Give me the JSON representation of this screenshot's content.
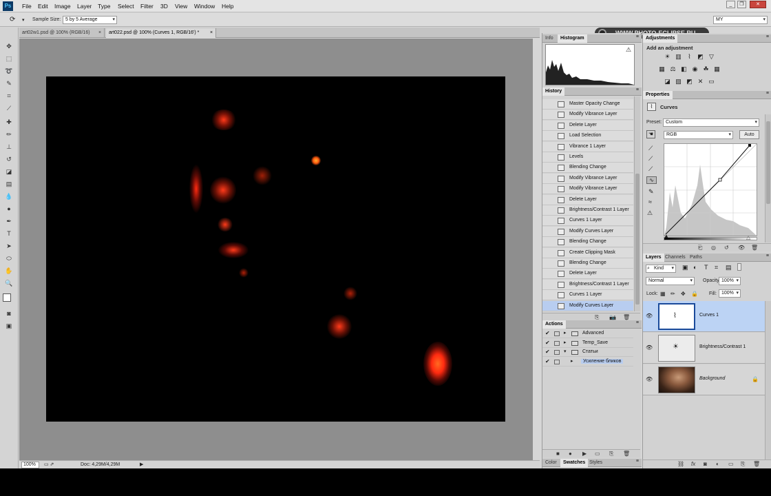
{
  "menubar": {
    "logo": "Ps",
    "items": [
      "File",
      "Edit",
      "Image",
      "Layer",
      "Type",
      "Select",
      "Filter",
      "3D",
      "View",
      "Window",
      "Help"
    ]
  },
  "options": {
    "sample_size_label": "Sample Size:",
    "sample_size_value": "5 by 5 Average",
    "watermark": "WWW.PHOTO-ECLIPSE.RU",
    "workspace": "MY"
  },
  "tabs": [
    {
      "label": "art02w1.psd @ 100% (RGB/16)",
      "close": "×"
    },
    {
      "label": "art022.psd @ 100% (Curves 1, RGB/16') *",
      "close": "×"
    }
  ],
  "status": {
    "zoom": "100%",
    "doc": "Doc: 4,29M/4,29M"
  },
  "panels": {
    "info_tab": "Info",
    "histogram_tab": "Histogram",
    "history_tab": "History",
    "actions_tab": "Actions",
    "color_tab": "Color",
    "swatches_tab": "Swatches",
    "styles_tab": "Styles",
    "adjustments_tab": "Adjustments",
    "add_adjustment": "Add an adjustment",
    "properties_tab": "Properties",
    "layers_tab": "Layers",
    "channels_tab": "Channels",
    "paths_tab": "Paths"
  },
  "history": [
    "Master Opacity Change",
    "Modify Vibrance Layer",
    "Delete Layer",
    "Load Selection",
    "Vibrance 1 Layer",
    "Levels",
    "Blending Change",
    "Modify Vibrance Layer",
    "Modify Vibrance Layer",
    "Delete Layer",
    "Brightness/Contrast 1 Layer",
    "Curves 1 Layer",
    "Modify Curves Layer",
    "Blending Change",
    "Create Clipping Mask",
    "Blending Change",
    "Delete Layer",
    "Brightness/Contrast 1 Layer",
    "Curves 1 Layer",
    "Modify Curves Layer"
  ],
  "actions": [
    {
      "label": "Advanced",
      "indent": 0,
      "open": false
    },
    {
      "label": "Temp_Save",
      "indent": 0,
      "open": false
    },
    {
      "label": "Статьи",
      "indent": 0,
      "open": true
    },
    {
      "label": "Усиление бликов",
      "indent": 1,
      "open": false,
      "selected": true
    }
  ],
  "properties": {
    "title": "Curves",
    "preset_label": "Preset:",
    "preset_value": "Custom",
    "channel": "RGB",
    "auto": "Auto"
  },
  "layers_controls": {
    "kind": "Kind",
    "blend": "Normal",
    "opacity_label": "Opacity:",
    "opacity": "100%",
    "lock_label": "Lock:",
    "fill_label": "Fill:",
    "fill": "100%"
  },
  "layers": [
    {
      "name": "Curves 1",
      "selected": true
    },
    {
      "name": "Brightness/Contrast 1",
      "selected": false
    },
    {
      "name": "Background",
      "selected": false,
      "locked": true
    }
  ],
  "colors": {
    "highlight": "#b8cdf0",
    "spark": "#ff3b1a"
  }
}
